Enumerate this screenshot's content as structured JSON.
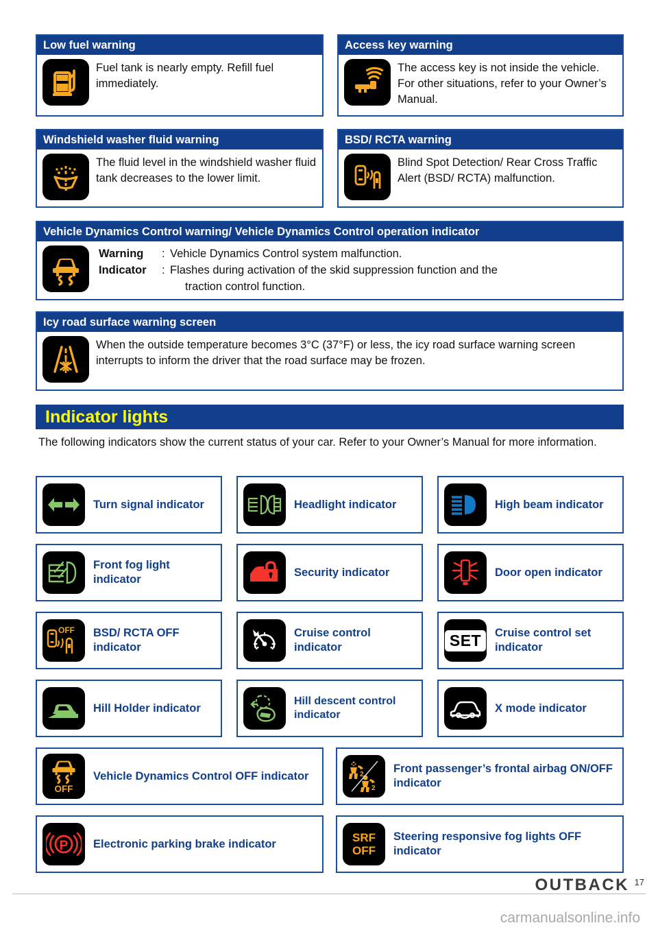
{
  "warnings": [
    {
      "id": "low-fuel",
      "title": "Low fuel warning",
      "icon": "fuel-pump-icon",
      "text": "Fuel tank is nearly empty. Refill fuel immediately."
    },
    {
      "id": "access-key",
      "title": "Access key warning",
      "icon": "access-key-icon",
      "text": "The access key is not inside the vehicle. For other situations, refer to your Owner’s Manual."
    },
    {
      "id": "washer-fluid",
      "title": "Windshield washer fluid warning",
      "icon": "washer-fluid-icon",
      "text": "The fluid level in the windshield washer fluid tank decreases to the lower limit."
    },
    {
      "id": "bsd-rcta",
      "title": "BSD/ RCTA warning",
      "icon": "bsd-rcta-icon",
      "text": "Blind Spot Detection/ Rear Cross Traffic Alert (BSD/ RCTA) malfunction."
    }
  ],
  "vehicle_dynamics": {
    "title": "Vehicle Dynamics Control warning/ Vehicle Dynamics Control operation indicator",
    "icon": "skid-car-icon",
    "rows": [
      {
        "label": "Warning",
        "colon": ":",
        "value": "Vehicle Dynamics Control system malfunction.",
        "value_cont": ""
      },
      {
        "label": "Indicator",
        "colon": ":",
        "value": "Flashes during activation of the skid suppression function and the",
        "value_cont": "traction control function."
      }
    ]
  },
  "icy_road": {
    "title": "Icy road surface warning screen",
    "icon": "icy-road-icon",
    "text": "When the outside temperature becomes 3°C (37°F) or less, the icy road surface warning screen interrupts to inform the driver that the road surface may be frozen."
  },
  "section": {
    "banner": "Indicator lights",
    "intro": "The following indicators show the current status of your car. Refer to your Owner’s Manual for more information."
  },
  "indicators": [
    {
      "id": "turn-signal",
      "icon": "turn-signal-icon",
      "label": "Turn signal indicator"
    },
    {
      "id": "headlight",
      "icon": "headlight-icon",
      "label": "Headlight indicator"
    },
    {
      "id": "high-beam",
      "icon": "high-beam-icon",
      "label": "High beam indicator"
    },
    {
      "id": "front-fog-light",
      "icon": "front-fog-light-icon",
      "label": "Front fog light indicator"
    },
    {
      "id": "security",
      "icon": "security-icon",
      "label": "Security indicator"
    },
    {
      "id": "door-open",
      "icon": "door-open-icon",
      "label": "Door open indicator"
    },
    {
      "id": "bsd-rcta-off",
      "icon": "bsd-rcta-off-icon",
      "label": "BSD/ RCTA OFF indicator"
    },
    {
      "id": "cruise-control",
      "icon": "cruise-control-icon",
      "label": "Cruise control indicator"
    },
    {
      "id": "cruise-set",
      "icon": "cruise-set-icon",
      "label": "Cruise control set indicator"
    },
    {
      "id": "hill-holder",
      "icon": "hill-holder-icon",
      "label": "Hill Holder indicator"
    },
    {
      "id": "hill-descent",
      "icon": "hill-descent-icon",
      "label": "Hill descent control indicator"
    },
    {
      "id": "x-mode",
      "icon": "x-mode-icon",
      "label": "X mode indicator"
    },
    {
      "id": "vdc-off",
      "icon": "vdc-off-icon",
      "label": "Vehicle Dynamics Control OFF indicator"
    },
    {
      "id": "passenger-airbag",
      "icon": "passenger-airbag-icon",
      "label": "Front passenger’s frontal airbag ON/OFF indicator"
    },
    {
      "id": "parking-brake",
      "icon": "electronic-parking-brake-icon",
      "label": "Electronic parking brake indicator"
    },
    {
      "id": "srf-off",
      "icon": "srf-off-icon",
      "label": "Steering responsive fog lights OFF indicator"
    }
  ],
  "icon_text": {
    "bsd_off": "OFF",
    "cruise_set": "SET",
    "vdc_off": "OFF",
    "srf": "SRF",
    "srf_off": "OFF",
    "parking_brake_p": "P",
    "airbag_2a": "2",
    "airbag_2b": "2"
  },
  "footer": {
    "brand": "OUTBACK",
    "page_number": "17",
    "watermark": "carmanualsonline.info"
  },
  "colors": {
    "header_blue": "#123f8c",
    "border_blue": "#1a4f9c",
    "banner_yellow": "#ffff00",
    "amber": "#f5a623",
    "green": "#86c76a",
    "red": "#f5352b",
    "white": "#ffffff",
    "blue_icon": "#1479c4"
  }
}
